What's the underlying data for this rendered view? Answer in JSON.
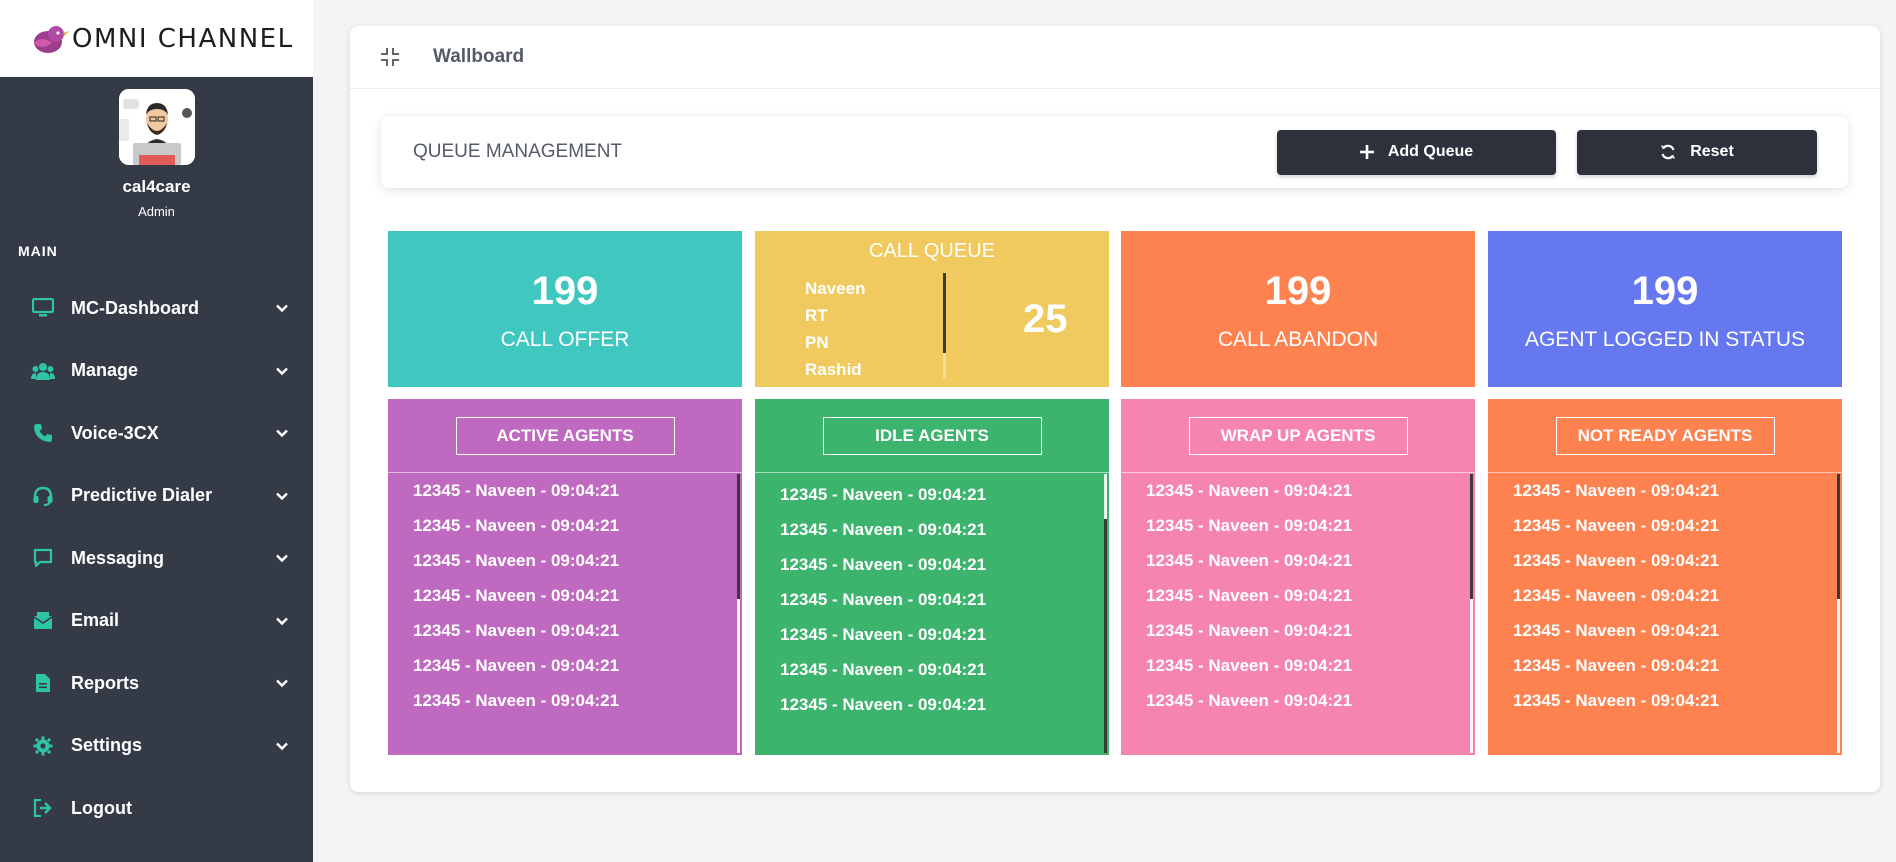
{
  "brand": {
    "name": "OMNI CHANNEL"
  },
  "user": {
    "name": "cal4care",
    "role": "Admin"
  },
  "sidebar": {
    "section": "MAIN",
    "items": [
      {
        "label": "MC-Dashboard",
        "icon": "monitor-icon",
        "has_submenu": true
      },
      {
        "label": "Manage",
        "icon": "users-icon",
        "has_submenu": true
      },
      {
        "label": "Voice-3CX",
        "icon": "phone-icon",
        "has_submenu": true
      },
      {
        "label": "Predictive Dialer",
        "icon": "headset-icon",
        "has_submenu": true
      },
      {
        "label": "Messaging",
        "icon": "message-icon",
        "has_submenu": true
      },
      {
        "label": "Email",
        "icon": "email-icon",
        "has_submenu": true
      },
      {
        "label": "Reports",
        "icon": "document-icon",
        "has_submenu": true
      },
      {
        "label": "Settings",
        "icon": "gear-icon",
        "has_submenu": true
      },
      {
        "label": "Logout",
        "icon": "logout-icon",
        "has_submenu": false
      }
    ]
  },
  "page": {
    "title": "Wallboard"
  },
  "queue": {
    "title": "QUEUE MANAGEMENT",
    "add_label": "Add Queue",
    "reset_label": "Reset"
  },
  "tiles": {
    "call_offer": {
      "value": "199",
      "label": "CALL OFFER"
    },
    "call_queue": {
      "label": "CALL QUEUE",
      "names": [
        "Naveen",
        "RT",
        "PN",
        "Rashid"
      ],
      "count": "25"
    },
    "call_abandon": {
      "value": "199",
      "label": "CALL ABANDON"
    },
    "agent_logged_in": {
      "value": "199",
      "label": "AGENT LOGGED IN STATUS"
    }
  },
  "panels": {
    "active": {
      "title": "ACTIVE AGENTS",
      "rows": [
        "12345 - Naveen - 09:04:21",
        "12345 - Naveen - 09:04:21",
        "12345 - Naveen - 09:04:21",
        "12345 - Naveen - 09:04:21",
        "12345 - Naveen - 09:04:21",
        "12345 - Naveen - 09:04:21",
        "12345 - Naveen - 09:04:21"
      ]
    },
    "idle": {
      "title": "IDLE AGENTS",
      "rows": [
        "12345 - Naveen - 09:04:21",
        "12345 - Naveen - 09:04:21",
        "12345 - Naveen - 09:04:21",
        "12345 - Naveen - 09:04:21",
        "12345 - Naveen - 09:04:21",
        "12345 - Naveen - 09:04:21",
        "12345 - Naveen - 09:04:21"
      ]
    },
    "wrapup": {
      "title": "WRAP UP AGENTS",
      "rows": [
        "12345 - Naveen - 09:04:21",
        "12345 - Naveen - 09:04:21",
        "12345 - Naveen - 09:04:21",
        "12345 - Naveen - 09:04:21",
        "12345 - Naveen - 09:04:21",
        "12345 - Naveen - 09:04:21",
        "12345 - Naveen - 09:04:21"
      ]
    },
    "notready": {
      "title": "NOT READY AGENTS",
      "rows": [
        "12345 - Naveen - 09:04:21",
        "12345 - Naveen - 09:04:21",
        "12345 - Naveen - 09:04:21",
        "12345 - Naveen - 09:04:21",
        "12345 - Naveen - 09:04:21",
        "12345 - Naveen - 09:04:21",
        "12345 - Naveen - 09:04:21"
      ]
    }
  },
  "colors": {
    "sidebar": "#353a47",
    "accent_icon": "#2ec4a6",
    "call_offer": "#40c7bf",
    "call_queue": "#f0ca5e",
    "call_abandon": "#fe8150",
    "agent_logged_in": "#6678ef",
    "active": "#c069c0",
    "idle": "#3db46d",
    "wrapup": "#f585b0",
    "notready": "#fe8150",
    "button": "#2c313c"
  }
}
